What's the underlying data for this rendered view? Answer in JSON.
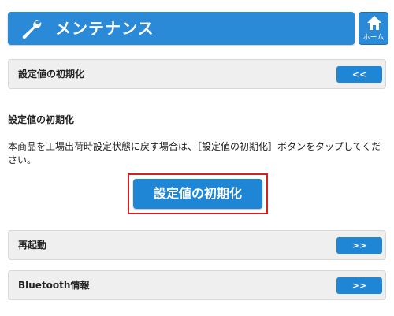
{
  "header": {
    "title": "メンテナンス",
    "icon": "wrench-icon",
    "color": "#2b8ad8"
  },
  "home_button": {
    "label": "ホーム",
    "icon": "home-icon"
  },
  "collapsed_section": {
    "label": "設定値の初期化",
    "toggle_label": "<<"
  },
  "reset_section": {
    "title": "設定値の初期化",
    "description": "本商品を工場出荷時設定状態に戻す場合は、［設定値の初期化］ボタンをタップしてください。",
    "button_label": "設定値の初期化",
    "highlight_color": "#d42020"
  },
  "menu_rows": [
    {
      "label": "再起動",
      "button_label": ">>"
    },
    {
      "label": "Bluetooth情報",
      "button_label": ">>"
    }
  ]
}
